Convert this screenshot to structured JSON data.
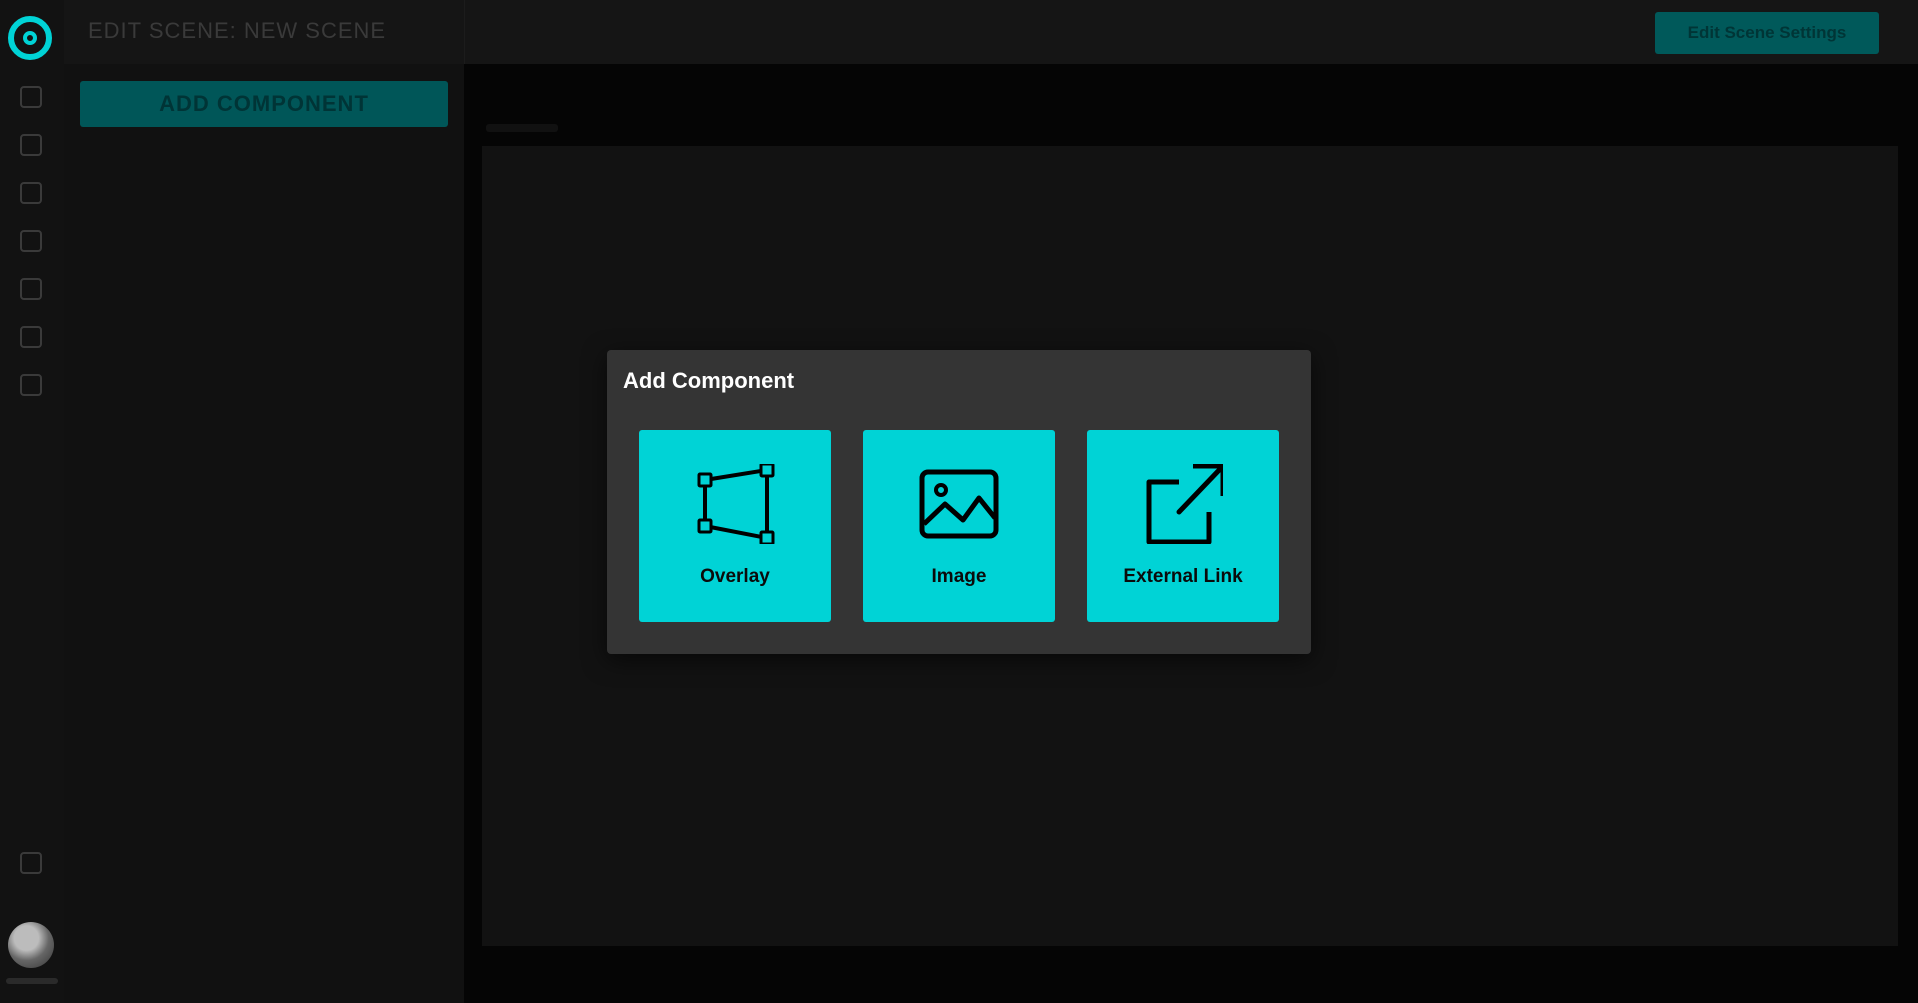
{
  "header": {
    "title": "EDIT SCENE: NEW SCENE",
    "settings_button": "Edit Scene Settings"
  },
  "side_panel": {
    "add_component_button": "ADD COMPONENT"
  },
  "modal": {
    "title": "Add Component",
    "options": [
      {
        "label": "Overlay",
        "icon": "overlay-shape-icon"
      },
      {
        "label": "Image",
        "icon": "image-icon"
      },
      {
        "label": "External Link",
        "icon": "external-link-icon"
      }
    ]
  },
  "colors": {
    "accent": "#00d3d6",
    "modal_bg": "#343434",
    "app_bg": "#0b0b0b"
  }
}
